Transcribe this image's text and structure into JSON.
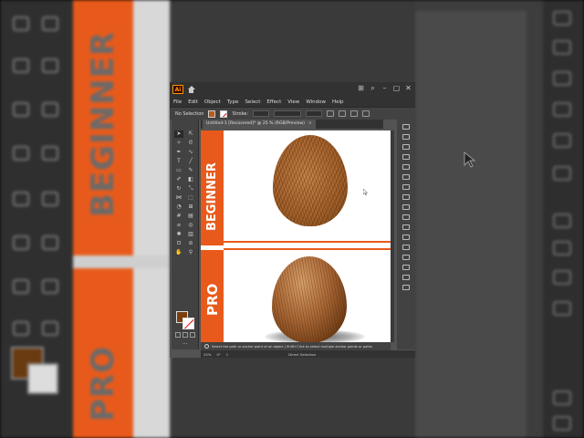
{
  "window": {
    "app_badge": "Ai",
    "menu": [
      "File",
      "Edit",
      "Object",
      "Type",
      "Select",
      "Effect",
      "View",
      "Window",
      "Help"
    ],
    "control": {
      "selection": "No Selection",
      "stroke_label": "Stroke:"
    },
    "document_tab": "Untitled-1 [Recovered]* @ 25 % (RGB/Preview)",
    "canvas": {
      "beginner_label": "BEGINNER",
      "pro_label": "PRO"
    },
    "status": "Select the path or anchor point of an object | Shift+Click to select multiple anchor points or paths",
    "bottom": {
      "zoom": "25%",
      "angle": "0°",
      "artboard": "1",
      "tool": "Direct Selection"
    }
  },
  "background": {
    "word_top": "BEGINNER",
    "word_bottom": "PRO"
  },
  "colors": {
    "orange": "#e85a1b",
    "fill": "#7a3e0f",
    "ui_dark": "#323232",
    "ui_mid": "#424242",
    "accent": "#1473e6"
  }
}
